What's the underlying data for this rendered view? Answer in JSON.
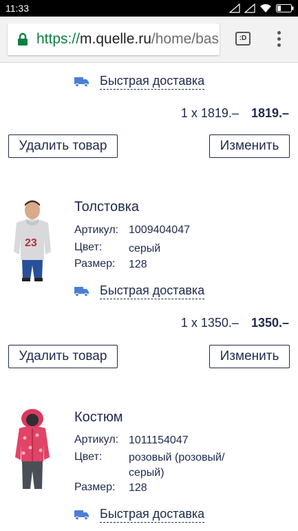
{
  "status_bar": {
    "time": "11:33"
  },
  "browser": {
    "url_scheme": "https://",
    "url_host": "m.quelle.ru",
    "url_path": "/home/bask",
    "tabs_label": ":D"
  },
  "items": [
    {
      "delivery": "Быстрая доставка",
      "quantity_price": "1 x 1819.–",
      "total": "1819.–",
      "delete_label": "Удалить товар",
      "change_label": "Изменить"
    },
    {
      "name": "Толстовка",
      "article_label": "Артикул:",
      "article": "1009404047",
      "color_label": "Цвет:",
      "color": "серый",
      "size_label": "Размер:",
      "size": "128",
      "delivery": "Быстрая доставка",
      "quantity_price": "1 x 1350.–",
      "total": "1350.–",
      "delete_label": "Удалить товар",
      "change_label": "Изменить"
    },
    {
      "name": "Костюм",
      "article_label": "Артикул:",
      "article": "1011154047",
      "color_label": "Цвет:",
      "color_line1": "розовый (розовый/",
      "color_line2": "серый)",
      "size_label": "Размер:",
      "size": "128",
      "delivery": "Быстрая доставка"
    }
  ],
  "colors": {
    "text": "#1d2a4d",
    "secure": "#0b8043",
    "truck": "#4a7fd4"
  }
}
